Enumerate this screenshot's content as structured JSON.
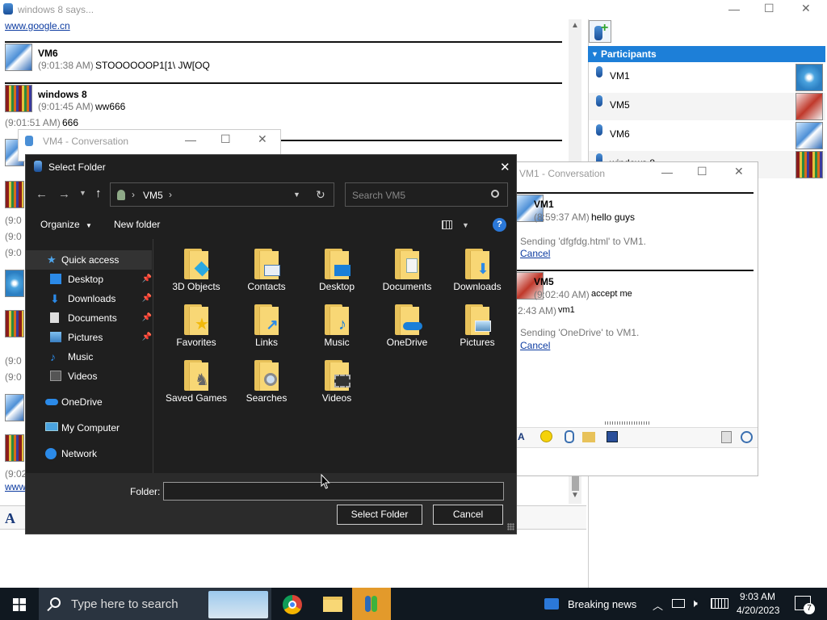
{
  "main_window": {
    "title": "windows 8 says...",
    "link_top": "www.google.cn",
    "messages": [
      {
        "name": "VM6",
        "time": "(9:01:38 AM)",
        "text": "STOOOOOOP1[1\\ JW[OQ"
      },
      {
        "name": "windows 8",
        "time": "(9:01:45 AM)",
        "text": "ww666"
      }
    ],
    "extra_line": {
      "time": "(9:01:51 AM)",
      "text": "666"
    },
    "left_fragments": [
      "(9:0",
      "(9:0",
      "(9:0",
      "(9:0",
      "(9:0",
      "(9:02",
      "www"
    ],
    "format_letter": "A",
    "controls": {
      "minimize": "—",
      "maximize": "☐",
      "close": "✕"
    }
  },
  "participants": {
    "header": "Participants",
    "items": [
      {
        "name": "VM1"
      },
      {
        "name": "VM5"
      },
      {
        "name": "VM6"
      },
      {
        "name": "windows 8"
      }
    ]
  },
  "vm4_window": {
    "title": "VM4 - Conversation"
  },
  "vm1_window": {
    "title": "VM1 - Conversation",
    "messages": [
      {
        "name": "VM1",
        "time": "(8:59:37 AM)",
        "text": "hello guys"
      },
      {
        "name": "VM5",
        "time": "(9:02:40 AM)",
        "text": "accept me"
      }
    ],
    "transfer1": "Sending 'dfgfdg.html' to VM1.",
    "transfer2": "Sending 'OneDrive' to VM1.",
    "cancel_label": "Cancel",
    "partial_time": "2:43 AM)",
    "partial_text": "vm1"
  },
  "dialog": {
    "title": "Select Folder",
    "address": {
      "segment": "VM5"
    },
    "search_placeholder": "Search VM5",
    "toolbar": {
      "organize": "Organize",
      "new_folder": "New folder"
    },
    "nav": {
      "quick_access": "Quick access",
      "items": [
        "Desktop",
        "Downloads",
        "Documents",
        "Pictures",
        "Music",
        "Videos"
      ],
      "onedrive": "OneDrive",
      "my_computer": "My Computer",
      "network": "Network"
    },
    "folders": [
      "3D Objects",
      "Contacts",
      "Desktop",
      "Documents",
      "Downloads",
      "Favorites",
      "Links",
      "Music",
      "OneDrive",
      "Pictures",
      "Saved Games",
      "Searches",
      "Videos"
    ],
    "folder_label": "Folder:",
    "folder_value": "",
    "select_button": "Select Folder",
    "cancel_button": "Cancel"
  },
  "taskbar": {
    "search_placeholder": "Type here to search",
    "news": "Breaking news",
    "time": "9:03 AM",
    "date": "4/20/2023",
    "notification_count": "7"
  },
  "colors": {
    "accent": "#1d7fd8",
    "dialog_bg": "#1f1f1f",
    "taskbar_bg": "#101820"
  }
}
